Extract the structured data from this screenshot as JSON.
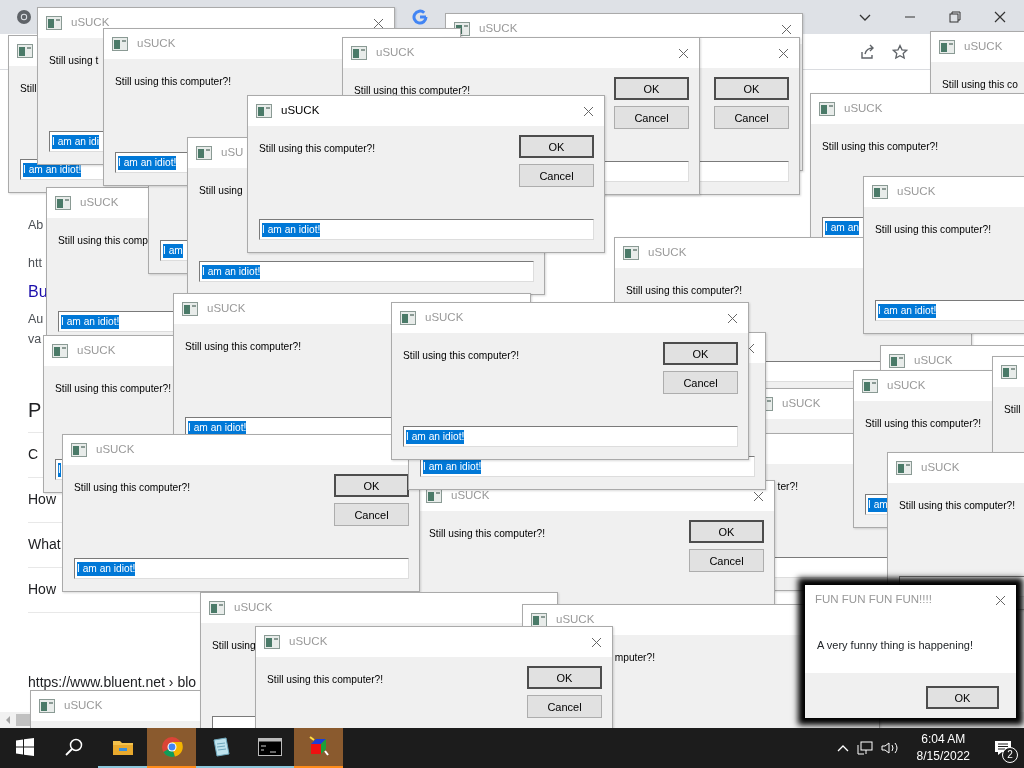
{
  "browser": {
    "page_items": [
      {
        "kind": "snippet",
        "text": "Ab"
      },
      {
        "kind": "snippet",
        "text": "htt"
      },
      {
        "kind": "title",
        "text": "Bu"
      },
      {
        "kind": "snippet",
        "text": "Au"
      },
      {
        "kind": "snippet",
        "text": "va"
      },
      {
        "kind": "heading",
        "text": "P"
      },
      {
        "kind": "question",
        "text": "C"
      },
      {
        "kind": "question",
        "text": "How"
      },
      {
        "kind": "question",
        "text": "What"
      },
      {
        "kind": "question",
        "text": "How"
      },
      {
        "kind": "source",
        "text": "https://www.bluent.net › blo"
      }
    ]
  },
  "windows": [
    {
      "kind": "prompt",
      "active": false,
      "title": "uSUCK"
    },
    {
      "kind": "prompt",
      "prompt": "Still",
      "input": "I am an idiot!"
    },
    {
      "kind": "prompt",
      "active": false,
      "title": "uSUCK",
      "prompt": "Still using t",
      "input": "I am an idi"
    },
    {
      "kind": "prompt",
      "active": false,
      "title": "uSUCK",
      "prompt": "Still using this computer?!",
      "input": "I am an idiot!"
    },
    {
      "kind": "prompt",
      "active": false,
      "title": "uSUCK",
      "prompt": "Still using this computer?!",
      "buttons": [
        "OK",
        "Cancel"
      ]
    },
    {
      "kind": "prompt",
      "buttons": [
        "OK",
        "Cancel"
      ]
    },
    {
      "kind": "prompt",
      "active": false,
      "title": "uSUCK",
      "prompt": "Still using this co"
    },
    {
      "kind": "prompt",
      "active": false,
      "title": "uSUCK",
      "prompt": "Still using this computer?!",
      "input": "I am an"
    },
    {
      "kind": "prompt",
      "active": false,
      "title": "uSUCK",
      "prompt": "Still using this computer?!",
      "input": "I am an idiot!"
    },
    {
      "kind": "prompt",
      "active": false,
      "title": "uSUCK",
      "prompt": "Still using this comp",
      "input": "I am an idiot!"
    },
    {
      "kind": "prompt",
      "input": "I am"
    },
    {
      "kind": "prompt",
      "active": false,
      "title": "uSU",
      "prompt": "Still using",
      "input": "I am an idiot!"
    },
    {
      "kind": "prompt",
      "active": false,
      "title": "uSUCK",
      "prompt": "Still using this computer?!"
    },
    {
      "kind": "prompt",
      "active": true,
      "title": "uSUCK",
      "prompt": "Still using this computer?!",
      "buttons": [
        "OK",
        "Cancel"
      ],
      "input": "I am an idiot!"
    },
    {
      "kind": "prompt",
      "active": false,
      "title": "uSUCK",
      "prompt": "Still using this computer?!",
      "input": "I"
    },
    {
      "kind": "prompt",
      "active": false,
      "title": "uSUCK",
      "prompt": "Still using this computer?!",
      "input": "I am an idiot!"
    },
    {
      "kind": "prompt",
      "active": false,
      "title": "uSUCK"
    },
    {
      "kind": "prompt",
      "active": false,
      "title": "uSUCK"
    },
    {
      "kind": "prompt",
      "prompt": "ter?!"
    },
    {
      "kind": "prompt",
      "active": false,
      "title": "uSUCK",
      "prompt": "Still using this computer?!",
      "input": "I am"
    },
    {
      "kind": "prompt",
      "prompt": "Still"
    },
    {
      "kind": "prompt",
      "input": "I am an idiot!"
    },
    {
      "kind": "prompt",
      "active": false,
      "title": "uSUCK",
      "prompt": "Still using this computer?!",
      "buttons": [
        "OK",
        "Cancel"
      ]
    },
    {
      "kind": "prompt",
      "active": false,
      "title": "uSUCK",
      "prompt": "Still using this computer?!"
    },
    {
      "kind": "prompt",
      "active": false,
      "title": "uSUCK",
      "prompt": "Still using this computer?!",
      "buttons": [
        "OK",
        "Cancel"
      ],
      "input": "I am an idiot!"
    },
    {
      "kind": "prompt",
      "active": false,
      "title": "uSUCK",
      "prompt": "Still using this computer?!",
      "buttons": [
        "OK",
        "Cancel"
      ],
      "input": "I am an idiot!"
    },
    {
      "kind": "prompt",
      "active": false,
      "title": "uSUCK"
    },
    {
      "kind": "prompt",
      "active": false,
      "title": "uSUCK",
      "prompt": "Still using"
    },
    {
      "kind": "prompt",
      "active": false,
      "title": "uSUCK",
      "prompt": "mputer?!"
    },
    {
      "kind": "prompt",
      "active": false,
      "title": "uSUCK",
      "prompt": "Still using this computer?!",
      "buttons": [
        "OK",
        "Cancel"
      ]
    },
    {
      "kind": "message",
      "title": "FUN FUN FUN FUN!!!!",
      "message": "A very funny thing is happening!",
      "buttons": [
        "OK"
      ]
    }
  ],
  "taskbar": {
    "apps": [
      {
        "kind": "start"
      },
      {
        "kind": "search"
      },
      {
        "kind": "folder",
        "flashing": false
      },
      {
        "kind": "browser",
        "flashing": true
      },
      {
        "kind": "notepad",
        "flashing": false
      },
      {
        "kind": "terminal",
        "flashing": false
      },
      {
        "kind": "cube",
        "flashing": true
      }
    ],
    "time": "6:04 AM",
    "date": "8/15/2022",
    "notification_count": "2"
  }
}
